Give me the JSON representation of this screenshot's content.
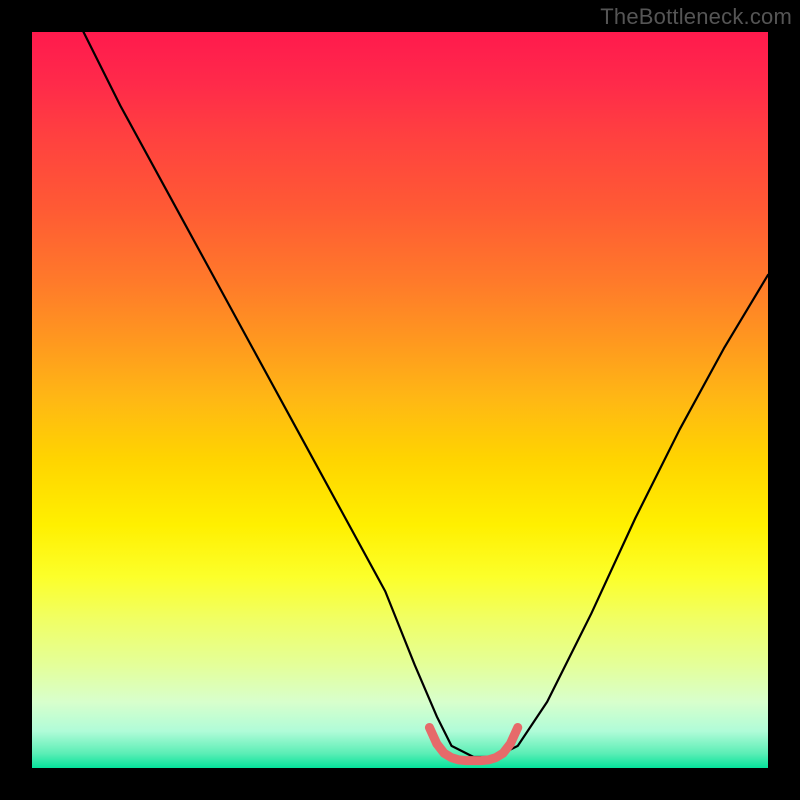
{
  "watermark": "TheBottleneck.com",
  "chart_data": {
    "type": "line",
    "title": "",
    "xlabel": "",
    "ylabel": "",
    "xlim": [
      0,
      100
    ],
    "ylim": [
      0,
      100
    ],
    "grid": false,
    "legend": false,
    "note": "Axes are unlabeled; data points are visual estimates of the plotted curve (x right, y up). Background gradient encodes a heat scale from red (top) to green (bottom).",
    "series": [
      {
        "name": "main-curve",
        "color": "#000000",
        "x": [
          7,
          12,
          18,
          24,
          30,
          36,
          42,
          48,
          52,
          55,
          57,
          60,
          63,
          66,
          70,
          76,
          82,
          88,
          94,
          100
        ],
        "y": [
          100,
          90,
          79,
          68,
          57,
          46,
          35,
          24,
          14,
          7,
          3,
          1.5,
          1.5,
          3,
          9,
          21,
          34,
          46,
          57,
          67
        ]
      },
      {
        "name": "bottom-highlight",
        "color": "#e66a6a",
        "x": [
          54,
          55,
          56,
          57,
          58,
          59,
          60,
          61,
          62,
          63,
          64,
          65,
          66
        ],
        "y": [
          5.5,
          3.3,
          2.0,
          1.4,
          1.1,
          1.0,
          1.0,
          1.0,
          1.1,
          1.4,
          2.0,
          3.3,
          5.5
        ]
      }
    ],
    "background_gradient": {
      "direction": "top-to-bottom",
      "stops": [
        {
          "pos": 0.0,
          "color": "#ff1a4d"
        },
        {
          "pos": 0.25,
          "color": "#ff6a30"
        },
        {
          "pos": 0.5,
          "color": "#ffb814"
        },
        {
          "pos": 0.7,
          "color": "#fff000"
        },
        {
          "pos": 0.9,
          "color": "#d8ffcc"
        },
        {
          "pos": 1.0,
          "color": "#05e29b"
        }
      ]
    }
  }
}
